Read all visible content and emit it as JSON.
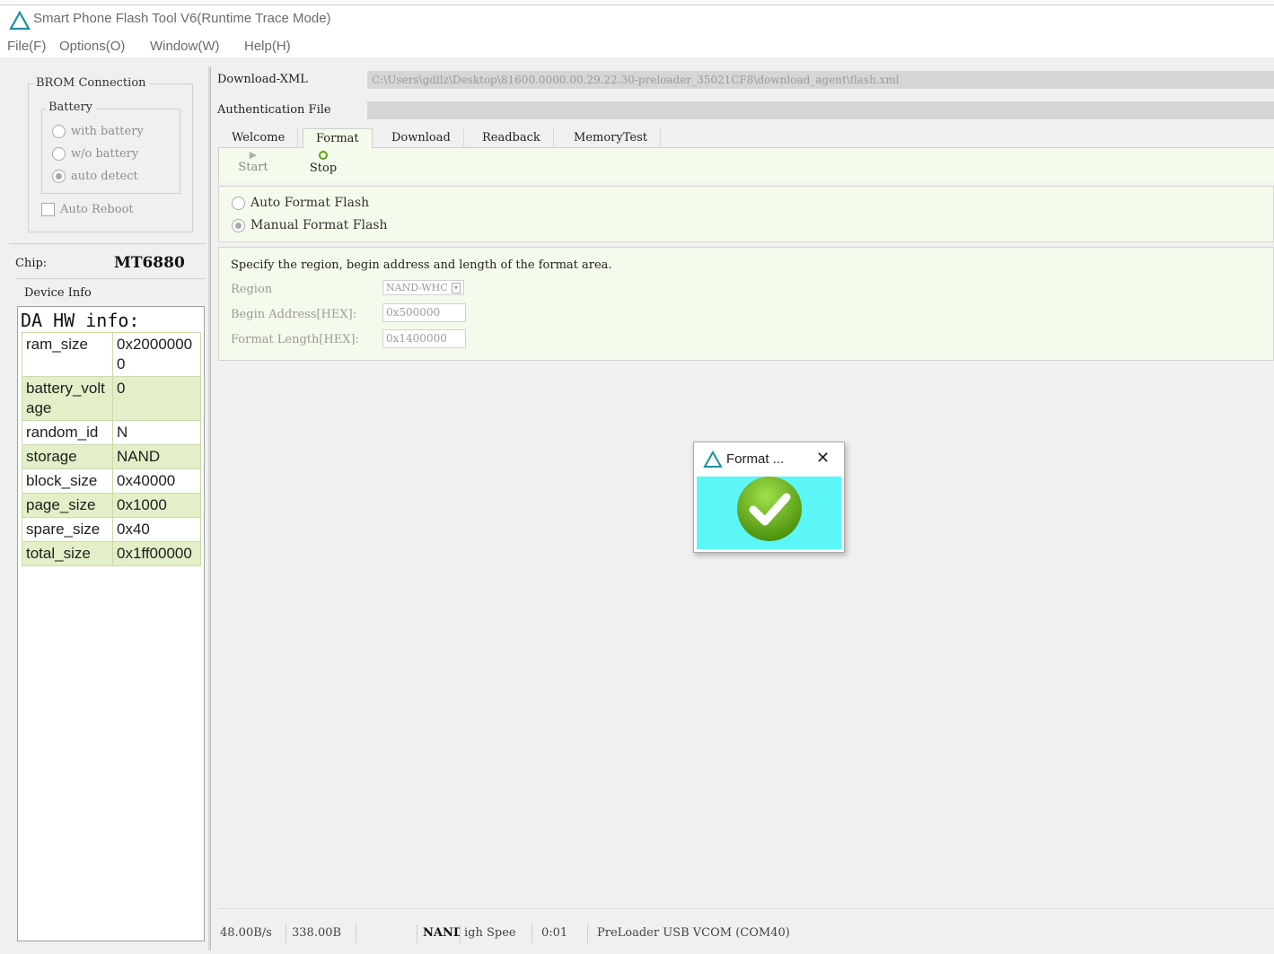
{
  "window": {
    "title": "Smart Phone Flash Tool V6(Runtime Trace Mode)"
  },
  "menu": [
    "File(F)",
    "Options(O)",
    "Window(W)",
    "Help(H)"
  ],
  "brom": {
    "title": "BROM Connection",
    "battery_title": "Battery",
    "options": [
      {
        "label": "with battery",
        "selected": false
      },
      {
        "label": "w/o battery",
        "selected": false
      },
      {
        "label": "auto detect",
        "selected": true
      }
    ],
    "auto_reboot": "Auto Reboot"
  },
  "chip": {
    "label": "Chip:",
    "value": "MT6880"
  },
  "device_info": {
    "title": "Device Info",
    "header": "DA HW info:",
    "rows": [
      {
        "key": "ram_size",
        "value": "0x20000000"
      },
      {
        "key": "battery_voltage",
        "value": "0"
      },
      {
        "key": "random_id",
        "value": "N"
      },
      {
        "key": "storage",
        "value": "NAND"
      },
      {
        "key": "block_size",
        "value": "0x40000"
      },
      {
        "key": "page_size",
        "value": "0x1000"
      },
      {
        "key": "spare_size",
        "value": "0x40"
      },
      {
        "key": "total_size",
        "value": "0x1ff00000"
      }
    ]
  },
  "download_xml": {
    "label": "Download-XML",
    "value": "C:\\Users\\gdllz\\Desktop\\81600.0000.00.29.22.30-preloader_35021CF8\\download_agent\\flash.xml"
  },
  "auth_file": {
    "label": "Authentication File",
    "value": ""
  },
  "tabs": [
    "Welcome",
    "Format",
    "Download",
    "Readback",
    "MemoryTest"
  ],
  "toolbar": {
    "start": "Start",
    "stop": "Stop"
  },
  "format_options": [
    {
      "label": "Auto Format Flash",
      "selected": false
    },
    {
      "label": "Manual Format Flash",
      "selected": true
    }
  ],
  "format_area": {
    "description": "Specify the region, begin address and length of the format area.",
    "region_label": "Region",
    "region_value": "NAND-WHC",
    "begin_label": "Begin Address[HEX]:",
    "begin_value": "0x500000",
    "length_label": "Format Length[HEX]:",
    "length_value": "0x1400000"
  },
  "status": {
    "speed": "48.00B/s",
    "size": "338.00B",
    "blank": "",
    "storage": "NAND",
    "mode": "igh Spee",
    "time": "0:01",
    "port": "PreLoader USB VCOM (COM40)"
  },
  "popup": {
    "title": "Format ...",
    "close": "✕"
  },
  "colors": {
    "accent_green": "#e3efc8",
    "panel_bg": "#f5fbec",
    "popup_body": "#5cf6f6",
    "ok_green": "#5fa313",
    "logo_teal": "#1a8fa0"
  }
}
